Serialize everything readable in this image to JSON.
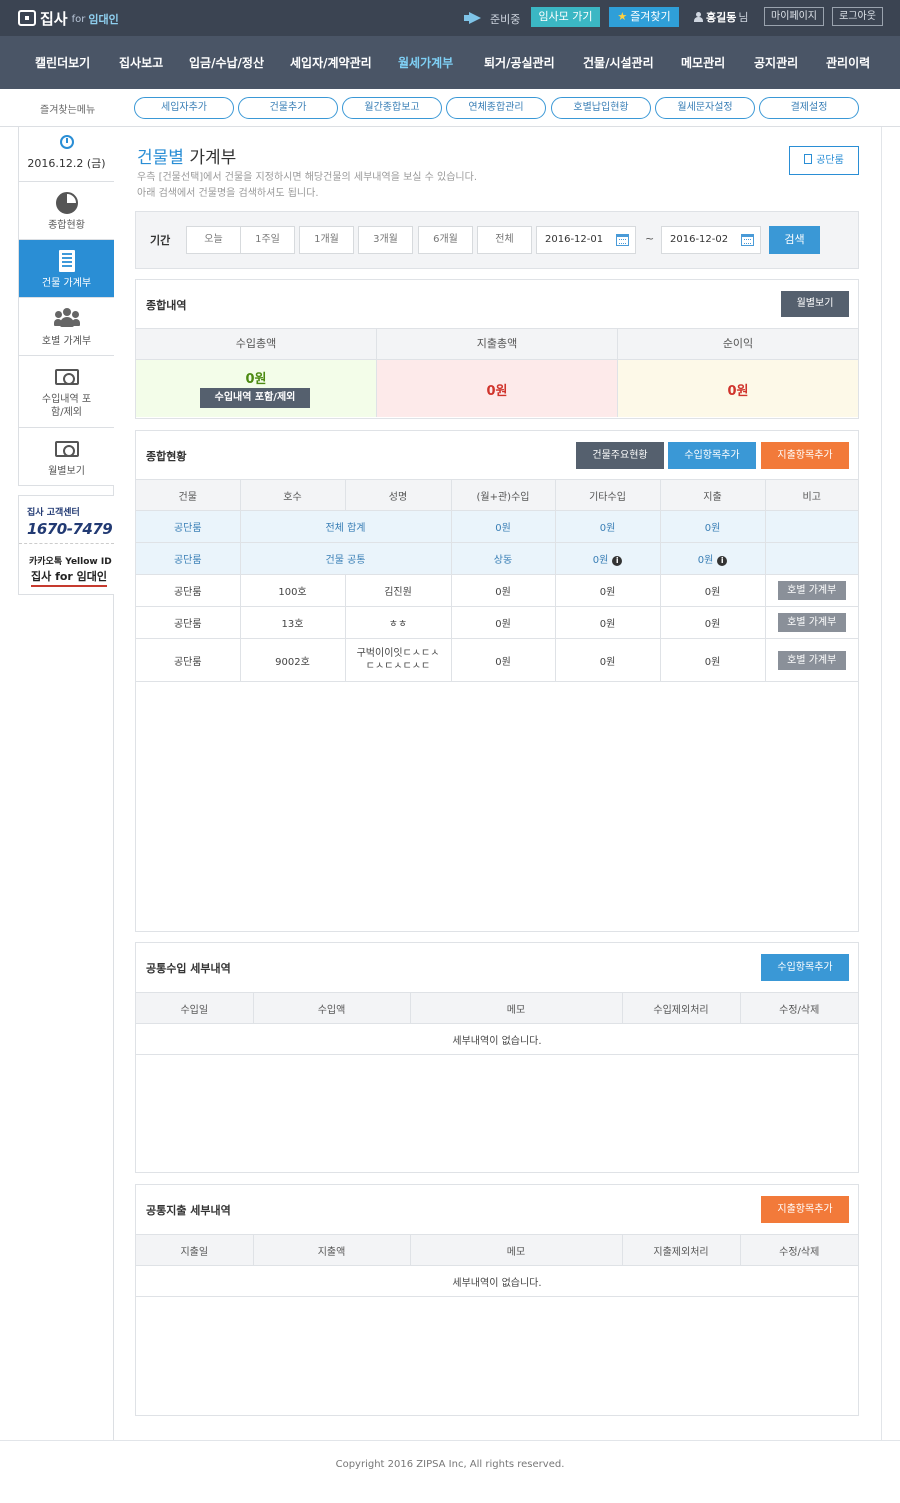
{
  "header": {
    "logo_main": "집사",
    "logo_for": "for",
    "logo_sub": "임대인",
    "status": "준비중",
    "go_button": "임사모 가기",
    "fav_button": "즐겨찾기",
    "user_name": "홍길동",
    "user_suffix": "님",
    "mypage": "마이페이지",
    "logout": "로그아웃"
  },
  "nav": {
    "items": [
      "캘린더보기",
      "집사보고",
      "입금/수납/정산",
      "세입자/계약관리",
      "월세가계부",
      "퇴거/공실관리",
      "건물/시설관리",
      "메모관리",
      "공지관리",
      "관리이력"
    ],
    "active_index": 4
  },
  "favorites": {
    "label": "즐겨찾는메뉴",
    "items": [
      "세입자추가",
      "건물추가",
      "월간종합보고",
      "연체종합관리",
      "호별납입현황",
      "월세문자설정",
      "결제설정"
    ]
  },
  "sidebar": {
    "date": "2016.12.2 (금)",
    "items": [
      {
        "label": "종합현황",
        "icon": "pie-chart-icon"
      },
      {
        "label": "건물 가계부",
        "icon": "building-icon"
      },
      {
        "label": "호별 가계부",
        "icon": "people-icon"
      },
      {
        "label": "수입내역 포함/제외",
        "icon": "money-icon"
      },
      {
        "label": "월별보기",
        "icon": "money-icon"
      }
    ],
    "active_index": 1,
    "promo": {
      "center": "집사 고객센터",
      "phone": "1670-7479",
      "kakao": "카카오톡 Yellow ID",
      "brand": "집사 for 임대인"
    }
  },
  "page": {
    "title_hl": "건물별",
    "title_rest": "가계부",
    "desc1": "우측 [건물선택]에서 건물을 지정하시면 해당건물의 세부내역을 보실 수 있습니다.",
    "desc2": "아래 검색에서 건물명을 검색하셔도 됩니다.",
    "building_button": "공단룸"
  },
  "filter": {
    "label": "기간",
    "ranges": [
      "오늘",
      "1주일",
      "1개월",
      "3개월",
      "6개월",
      "전체"
    ],
    "start_date": "2016-12-01",
    "end_date": "2016-12-02",
    "tilde": "~",
    "search": "검색"
  },
  "summary": {
    "title": "종합내역",
    "monthly_button": "월별보기",
    "income_label": "수입총액",
    "expense_label": "지출총액",
    "profit_label": "순이익",
    "income_value": "0원",
    "income_toggle": "수입내역 포함/제외",
    "expense_value": "0원",
    "profit_value": "0원"
  },
  "overview": {
    "title": "종합현황",
    "buttons": [
      "건물주요현황",
      "수입항목추가",
      "지출항목추가"
    ],
    "columns": [
      "건물",
      "호수",
      "성명",
      "(월+관)수입",
      "기타수입",
      "지출",
      "비고"
    ],
    "total_row": {
      "building": "공단룸",
      "label": "전체 합계",
      "income": "0원",
      "other": "0원",
      "expense": "0원"
    },
    "common_row": {
      "building": "공단룸",
      "label": "건물 공통",
      "income": "상동",
      "other": "0원",
      "expense": "0원"
    },
    "info_glyph": "i",
    "rows": [
      {
        "building": "공단룸",
        "unit": "100호",
        "name": "김진원",
        "income": "0원",
        "other": "0원",
        "expense": "0원",
        "action": "호별 가계부"
      },
      {
        "building": "공단룸",
        "unit": "13호",
        "name": "ㅎㅎ",
        "income": "0원",
        "other": "0원",
        "expense": "0원",
        "action": "호별 가계부"
      },
      {
        "building": "공단룸",
        "unit": "9002호",
        "name_line1": "구벅이이잇ㄷㅅㄷㅅ",
        "name_line2": "ㄷㅅㄷㅅㄷㅅㄷ",
        "income": "0원",
        "other": "0원",
        "expense": "0원",
        "action": "호별 가계부"
      }
    ]
  },
  "common_income": {
    "title": "공통수입 세부내역",
    "add_button": "수입항목추가",
    "columns": [
      "수입일",
      "수입액",
      "메모",
      "수입제외처리",
      "수정/삭제"
    ],
    "empty": "세부내역이 없습니다."
  },
  "common_expense": {
    "title": "공통지출 세부내역",
    "add_button": "지출항목추가",
    "columns": [
      "지출일",
      "지출액",
      "메모",
      "지출제외처리",
      "수정/삭제"
    ],
    "empty": "세부내역이 없습니다."
  },
  "footer": {
    "copyright": "Copyright 2016 ZIPSA Inc, All rights reserved."
  },
  "colors": {
    "topbar": "#3b4452",
    "nav": "#4a5566",
    "accent": "#2a8ed5",
    "orange": "#f27a3a",
    "income_bg": "#f3fde9",
    "expense_bg": "#fdeaea",
    "profit_bg": "#fdf9e8",
    "income_text": "#4c8a12",
    "expense_text": "#d0342c",
    "profit_text": "#d0342c"
  }
}
